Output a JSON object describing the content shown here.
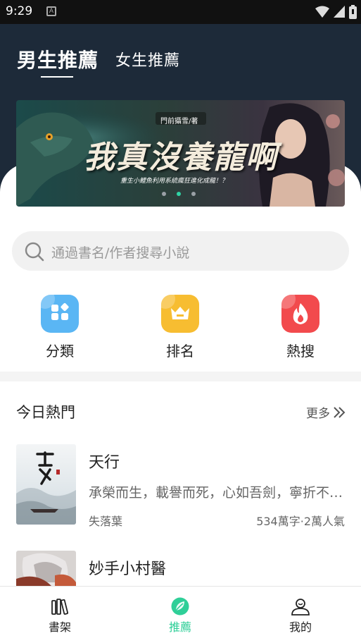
{
  "status_bar": {
    "time": "9:29",
    "notification_glyph": "A"
  },
  "tabs": [
    {
      "label": "男生推薦",
      "active": true
    },
    {
      "label": "女生推薦",
      "active": false
    }
  ],
  "banner": {
    "author": "門前攝雪/著",
    "title": "我真沒養龍啊",
    "subtitle": "重生小鯉魚利用系統瘋狂進化成龍！？",
    "dot_count": 3,
    "active_dot": 2
  },
  "search": {
    "placeholder": "通過書名/作者搜尋小說"
  },
  "categories": [
    {
      "label": "分類",
      "icon": "category-grid-icon",
      "color": "#5ab6f4"
    },
    {
      "label": "排名",
      "icon": "crown-icon",
      "color": "#f7bd31"
    },
    {
      "label": "熱搜",
      "icon": "flame-icon",
      "color": "#f24a4d"
    }
  ],
  "section": {
    "title": "今日熱門",
    "more_label": "更多"
  },
  "books": [
    {
      "title": "天行",
      "description": "承榮而生，載譽而死，心如吾劍，寧折不屈。",
      "author": "失落葉",
      "meta": "534萬字·2萬人氣"
    },
    {
      "title": "妙手小村醫"
    }
  ],
  "bottom_nav": [
    {
      "label": "書架",
      "icon": "bookshelf-icon",
      "active": false
    },
    {
      "label": "推薦",
      "icon": "recommend-leaf-icon",
      "active": true
    },
    {
      "label": "我的",
      "icon": "profile-icon",
      "active": false
    }
  ],
  "colors": {
    "accent": "#2fcf98",
    "header_bg": "#1d2a39"
  }
}
